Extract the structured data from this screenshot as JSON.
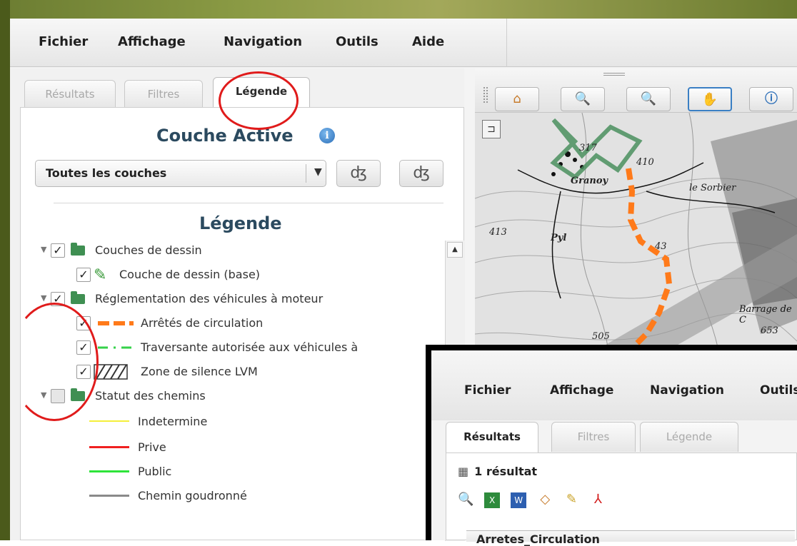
{
  "menu": {
    "items": [
      "Fichier",
      "Affichage",
      "Navigation",
      "Outils",
      "Aide"
    ]
  },
  "tabs": [
    "Résultats",
    "Filtres",
    "Légende"
  ],
  "active_layer": {
    "title": "Couche Active",
    "info_icon": "info-icon",
    "select_value": "Toutes les couches"
  },
  "legend": {
    "title": "Légende",
    "items": [
      "Couches de dessin",
      "Couche de dessin (base)",
      "Réglementation des véhicules à moteur",
      "Arrêtés de circulation",
      "Traversante autorisée aux véhicules à",
      "Zone de silence LVM",
      "Statut des chemins",
      "Indetermine",
      "Prive",
      "Public",
      "Chemin goudronné"
    ]
  },
  "map": {
    "labels": [
      "317",
      "410",
      "Granoy",
      "le Sorbier",
      "413",
      "Pyl",
      "43",
      "Barrage de C",
      "505",
      "653"
    ]
  },
  "inset": {
    "menu": [
      "Fichier",
      "Affichage",
      "Navigation",
      "Outils"
    ],
    "tabs": [
      "Résultats",
      "Filtres",
      "Légende"
    ],
    "result_count": "1 résultat",
    "table_header": "Arretes_Circulation"
  },
  "colors": {
    "accent": "#2b4a5f",
    "annotation": "#e01b1b",
    "arretes": "#ff7a1a",
    "traversante": "#35d14a",
    "indetermine": "#f4ef3a",
    "prive": "#f02020",
    "public": "#2ee43a",
    "goudronne": "#8a8a8a",
    "trail": "#4a8f5e"
  }
}
